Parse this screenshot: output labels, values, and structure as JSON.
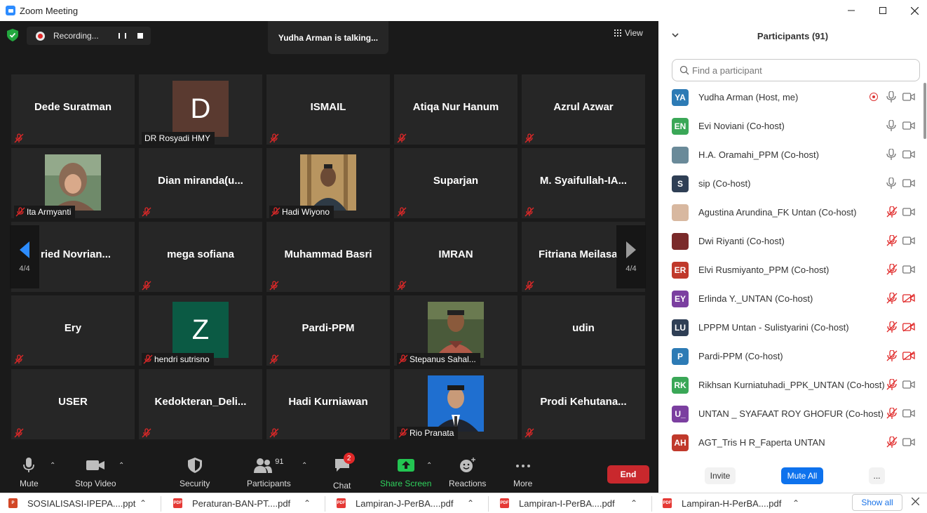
{
  "window": {
    "title": "Zoom Meeting"
  },
  "meeting": {
    "recording_text": "Recording...",
    "talking_text": "Yudha Arman is talking...",
    "view_label": "View",
    "page_left": "4/4",
    "page_right": "4/4",
    "tiles": [
      "Dede Suratman",
      "DR Rosyadi HMY",
      "ISMAIL",
      "Atiqa Nur Hanum",
      "Azrul Azwar",
      "Ita Armyanti",
      "Dian  miranda(u...",
      "Hadi Wiyono",
      "Suparjan",
      "M.  Syaifullah-IA...",
      "ried  Novrian...",
      "mega sofiana",
      "Muhammad Basri",
      "IMRAN",
      "Fitriana  Meilasa",
      "Ery",
      "hendri sutrisno",
      "Pardi-PPM",
      "Stepanus Sahal...",
      "udin",
      "USER",
      "Kedokteran_Deli...",
      "Hadi Kurniawan",
      "Rio Pranata",
      "Prodi  Kehutana..."
    ],
    "avatar_letters": {
      "d": "D",
      "z": "Z"
    }
  },
  "toolbar": {
    "mute": "Mute",
    "stop_video": "Stop Video",
    "security": "Security",
    "participants": "Participants",
    "participants_count": "91",
    "chat": "Chat",
    "chat_badge": "2",
    "share_screen": "Share Screen",
    "reactions": "Reactions",
    "more": "More",
    "end": "End"
  },
  "panel": {
    "title": "Participants (91)",
    "search_placeholder": "Find a participant",
    "participants": [
      {
        "initials": "YA",
        "name": "Yudha Arman (Host, me)",
        "color": "#2d7bb5",
        "mic": "on",
        "video": "on"
      },
      {
        "initials": "EN",
        "name": "Evi Noviani (Co-host)",
        "color": "#3aa757",
        "mic": "on",
        "video": "on"
      },
      {
        "initials": "",
        "name": "H.A. Oramahi_PPM (Co-host)",
        "color": "#6a8a99",
        "mic": "on",
        "video": "on"
      },
      {
        "initials": "S",
        "name": "sip (Co-host)",
        "color": "#2f3f55",
        "mic": "on",
        "video": "on"
      },
      {
        "initials": "",
        "name": "Agustina Arundina_FK Untan (Co-host)",
        "color": "#d8b8a0",
        "mic": "muted",
        "video": "on"
      },
      {
        "initials": "",
        "name": "Dwi Riyanti (Co-host)",
        "color": "#7a2a2a",
        "mic": "muted",
        "video": "on"
      },
      {
        "initials": "ER",
        "name": "Elvi Rusmiyanto_PPM (Co-host)",
        "color": "#c0392b",
        "mic": "muted",
        "video": "on"
      },
      {
        "initials": "EY",
        "name": "Erlinda Y._UNTAN (Co-host)",
        "color": "#7b3fa0",
        "mic": "muted",
        "video": "off"
      },
      {
        "initials": "LU",
        "name": "LPPPM Untan - Sulistyarini (Co-host)",
        "color": "#2f3f55",
        "mic": "muted",
        "video": "off"
      },
      {
        "initials": "P",
        "name": "Pardi-PPM (Co-host)",
        "color": "#2d7bb5",
        "mic": "muted",
        "video": "off"
      },
      {
        "initials": "RK",
        "name": "Rikhsan Kurniatuhadi_PPK_UNTAN (Co-host)",
        "color": "#3aa757",
        "mic": "muted",
        "video": "on"
      },
      {
        "initials": "U_",
        "name": "UNTAN _ SYAFAAT ROY GHOFUR (Co-host)",
        "color": "#7b3fa0",
        "mic": "muted",
        "video": "on"
      },
      {
        "initials": "AH",
        "name": "AGT_Tris H R_Faperta UNTAN",
        "color": "#c0392b",
        "mic": "muted",
        "video": "on"
      }
    ],
    "invite": "Invite",
    "mute_all": "Mute All",
    "more": "..."
  },
  "downloads": {
    "items": [
      {
        "name": "SOSIALISASI-IPEPA....ppt",
        "type": "ppt"
      },
      {
        "name": "Peraturan-BAN-PT....pdf",
        "type": "pdf"
      },
      {
        "name": "Lampiran-J-PerBA....pdf",
        "type": "pdf"
      },
      {
        "name": "Lampiran-I-PerBA....pdf",
        "type": "pdf"
      },
      {
        "name": "Lampiran-H-PerBA....pdf",
        "type": "pdf"
      }
    ],
    "show_all": "Show all"
  }
}
